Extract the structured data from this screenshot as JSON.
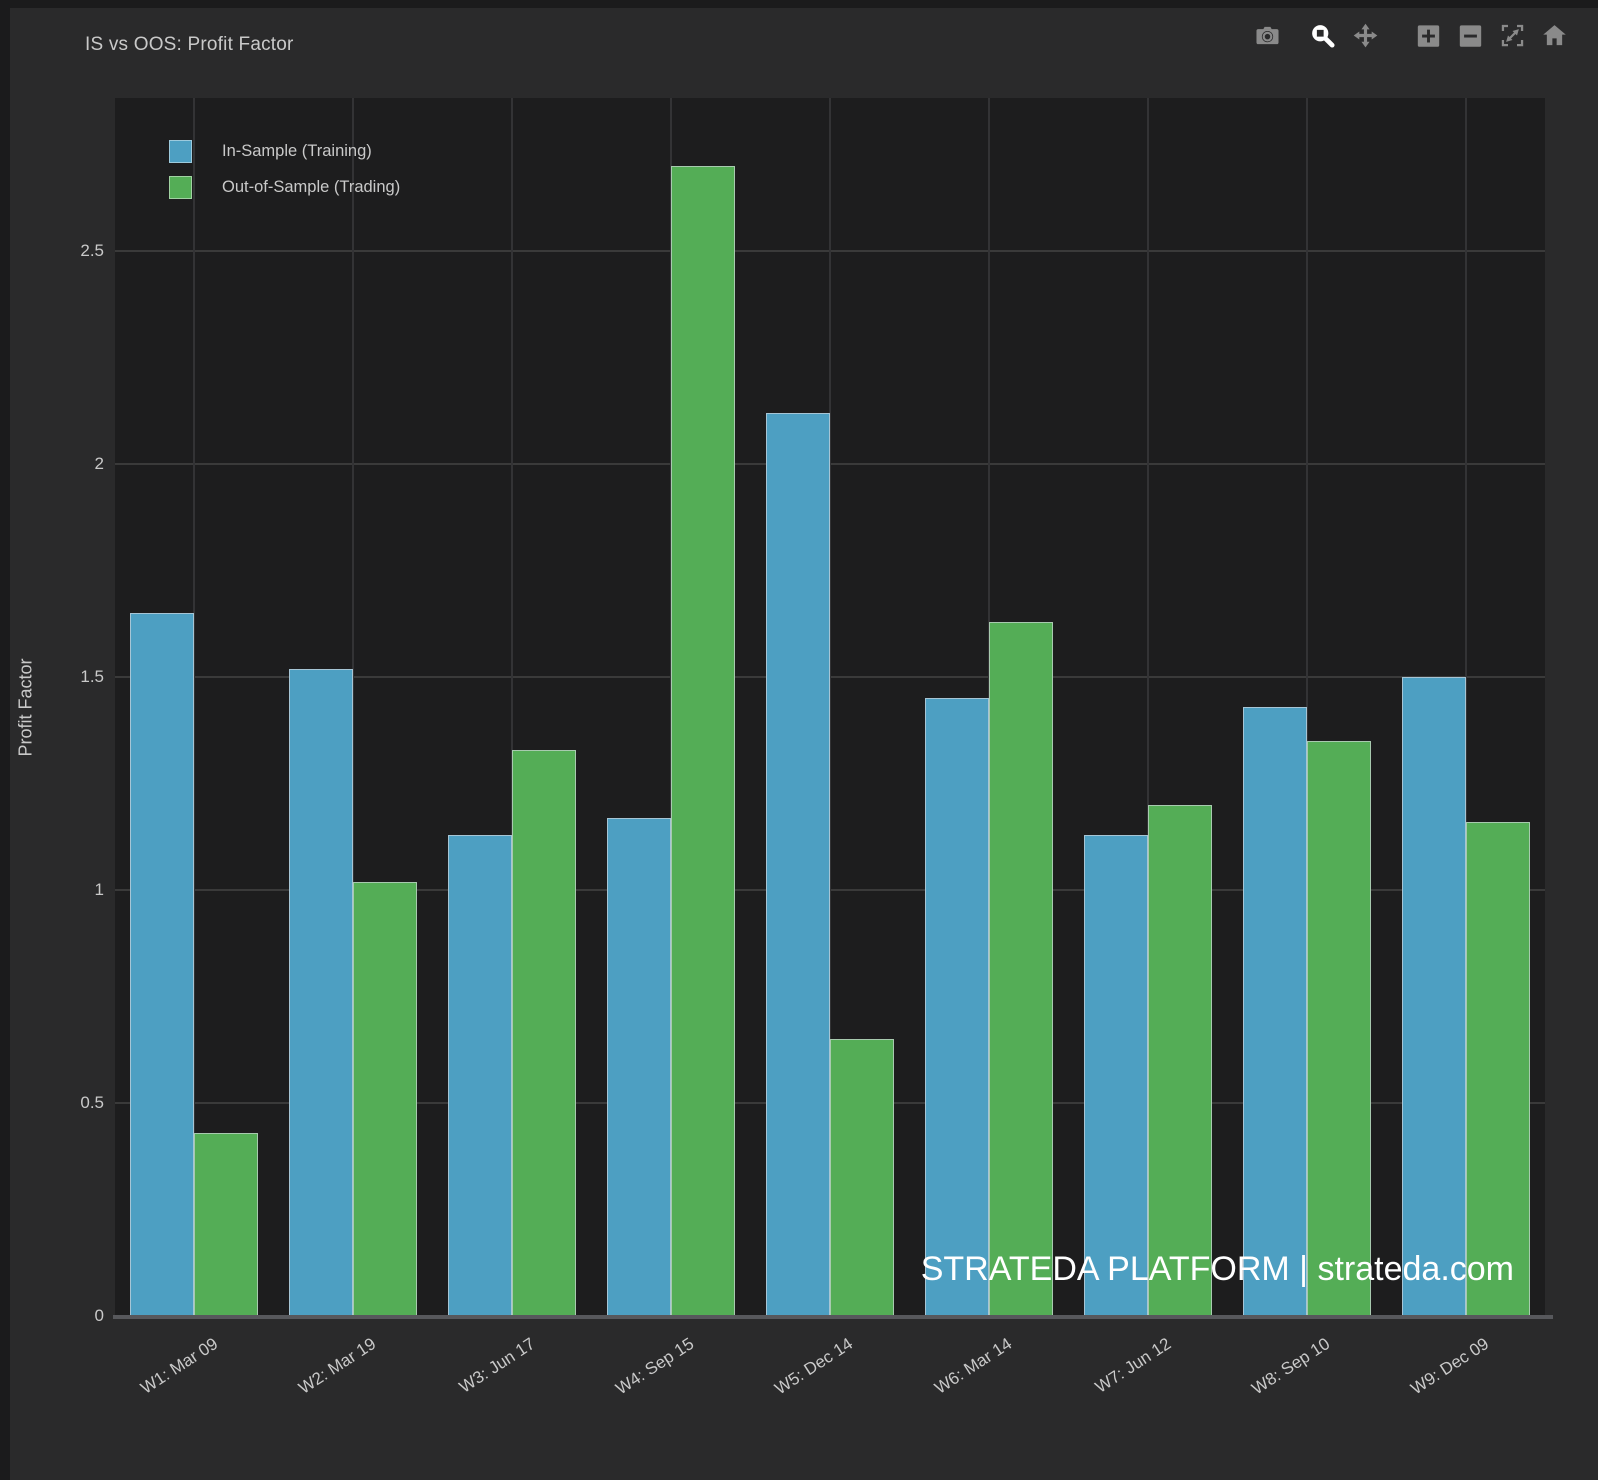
{
  "header": {
    "title": "IS vs OOS: Profit Factor"
  },
  "toolbar": {
    "icons": [
      "camera",
      "zoom-box",
      "pan",
      "zoom-in",
      "zoom-out",
      "autoscale",
      "reset-home"
    ],
    "active_icon": "zoom-box"
  },
  "watermark": {
    "text": "STRATEDA PLATFORM | strateda.com"
  },
  "colors": {
    "background": "#2A2A2B",
    "edge": "#1B1B1C",
    "plot_background": "#1D1D1E",
    "grid": "#3A3A3A",
    "grid_vertical": "#333335",
    "axis_line": "#57585C",
    "text": "#C9C9C9",
    "watermark": "#FFFFFF",
    "modebar_icon": "#8A8A8A",
    "modebar_active": "#FFFFFF",
    "in_sample": "#4D9FC2",
    "out_of_sample": "#54AD56"
  },
  "chart_data": {
    "type": "bar",
    "title": "IS vs OOS: Profit Factor",
    "categories": [
      "W1: Mar 09",
      "W2: Mar 19",
      "W3: Jun 17",
      "W4: Sep 15",
      "W5: Dec 14",
      "W6: Mar 14",
      "W7: Jun 12",
      "W8: Sep 10",
      "W9: Dec 09"
    ],
    "series": [
      {
        "name": "In-Sample (Training)",
        "color": "#4D9FC2",
        "values": [
          1.65,
          1.52,
          1.13,
          1.17,
          2.12,
          1.45,
          1.13,
          1.43,
          1.5
        ]
      },
      {
        "name": "Out-of-Sample (Trading)",
        "color": "#54AD56",
        "values": [
          0.43,
          1.02,
          1.33,
          2.7,
          0.65,
          1.63,
          1.2,
          1.35,
          1.16
        ]
      }
    ],
    "xlabel": "",
    "ylabel": "Profit Factor",
    "yticks": [
      0,
      0.5,
      1,
      1.5,
      2,
      2.5
    ],
    "ylim": [
      0,
      2.86
    ],
    "grid": true,
    "legend_position": "top-left",
    "bar_mode": "grouped"
  }
}
